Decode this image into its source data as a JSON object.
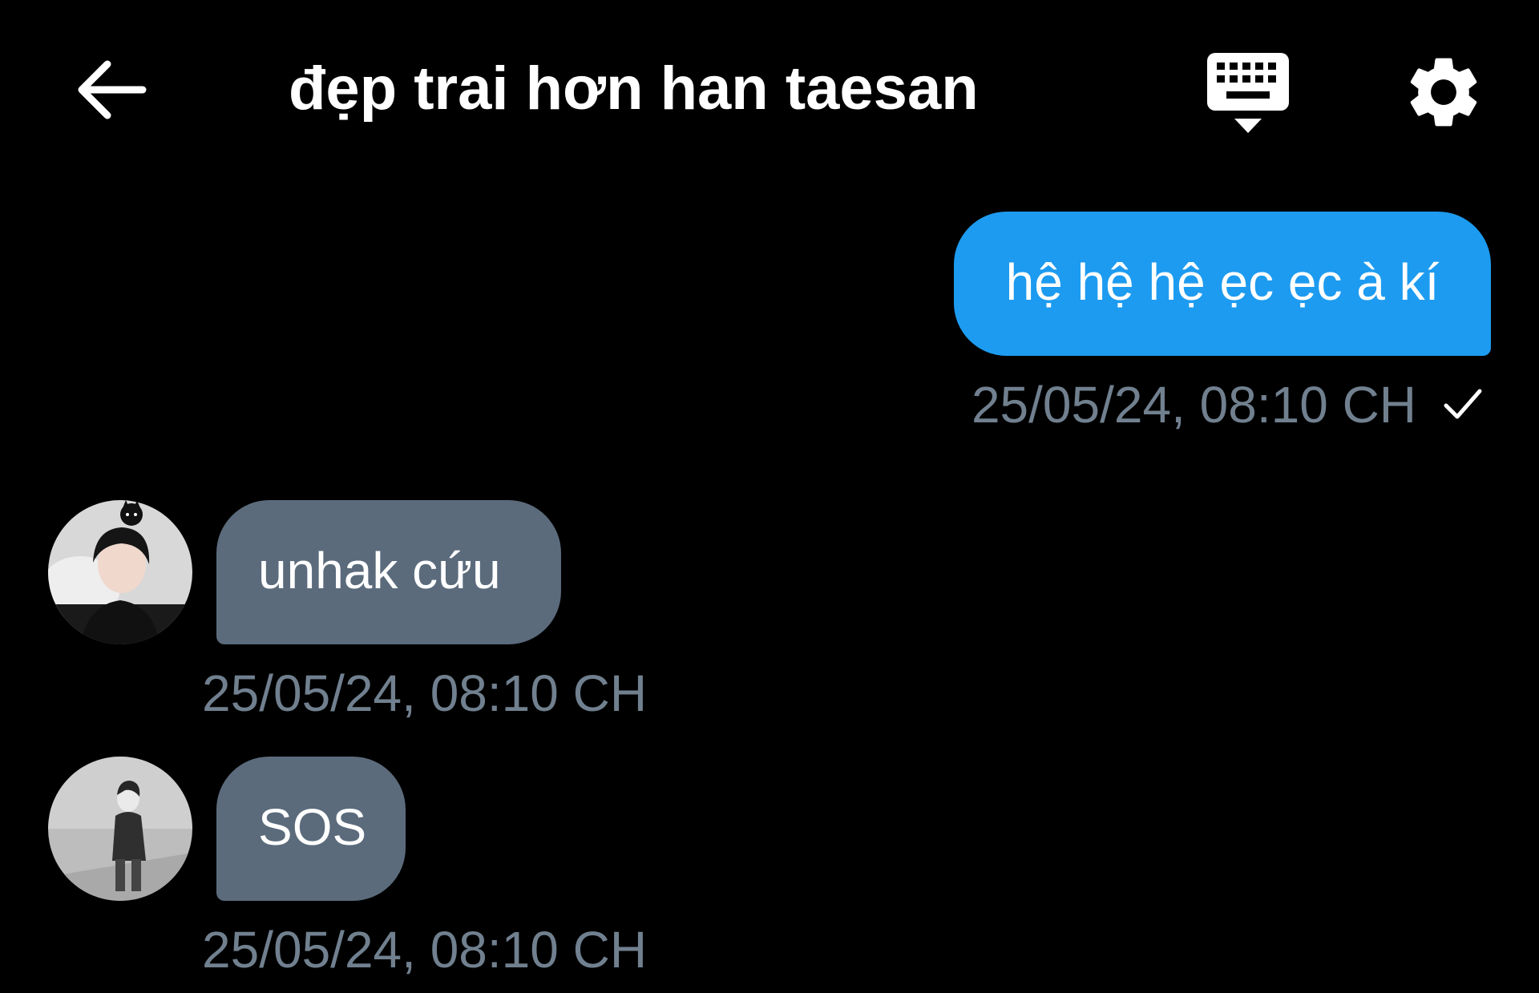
{
  "header": {
    "title": "đẹp trai hơn han taesan",
    "icons": {
      "back": "arrow-left-icon",
      "keyboard": "keyboard-hide-icon",
      "settings": "gear-icon"
    }
  },
  "messages": [
    {
      "direction": "outgoing",
      "text": "hệ hệ hệ ẹc ẹc à kí",
      "time": "25/05/24, 08:10 CH",
      "status_icon": "check-icon"
    },
    {
      "direction": "incoming",
      "text": "unhak cứu",
      "time": "25/05/24, 08:10 CH",
      "avatar": "avatar-photo"
    },
    {
      "direction": "incoming",
      "text": "SOS",
      "time": "25/05/24, 08:10 CH",
      "avatar": "avatar-photo-grayscale"
    }
  ],
  "colors": {
    "background": "#000000",
    "outgoing_bubble": "#1d9bf0",
    "incoming_bubble": "#5b6b7c",
    "timestamp": "#71808f",
    "text": "#ffffff"
  }
}
